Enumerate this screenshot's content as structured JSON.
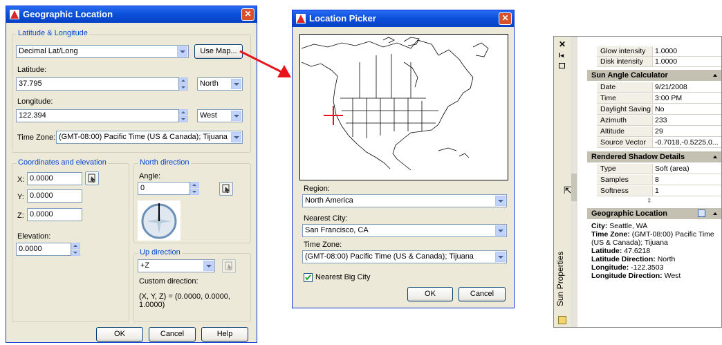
{
  "geo_dialog": {
    "title": "Geographic Location",
    "latlong_group": "Latitude & Longitude",
    "format_value": "Decimal Lat/Long",
    "use_map_label": "Use Map...",
    "latitude_label": "Latitude:",
    "latitude_value": "37.795",
    "latitude_dir": "North",
    "longitude_label": "Longitude:",
    "longitude_value": "122.394",
    "longitude_dir": "West",
    "timezone_label": "Time Zone:",
    "timezone_value": "(GMT-08:00) Pacific Time (US & Canada); Tijuana",
    "coords_group": "Coordinates and elevation",
    "x_label": "X:",
    "x_value": "0.0000",
    "y_label": "Y:",
    "y_value": "0.0000",
    "z_label": "Z:",
    "z_value": "0.0000",
    "elevation_label": "Elevation:",
    "elevation_value": "0.0000",
    "north_group": "North direction",
    "angle_label": "Angle:",
    "angle_value": "0",
    "up_group": "Up direction",
    "up_value": "+Z",
    "custom_dir_label": "Custom direction:",
    "custom_dir_value": "(X, Y, Z) = (0.0000, 0.0000, 1.0000)",
    "ok_label": "OK",
    "cancel_label": "Cancel",
    "help_label": "Help"
  },
  "picker_dialog": {
    "title": "Location Picker",
    "region_label": "Region:",
    "region_value": "North America",
    "city_label": "Nearest City:",
    "city_value": "San Francisco, CA",
    "timezone_label": "Time Zone:",
    "timezone_value": "(GMT-08:00) Pacific Time (US & Canada); Tijuana",
    "nearest_big_city_label": "Nearest Big City",
    "nearest_big_city_checked": true,
    "ok_label": "OK",
    "cancel_label": "Cancel"
  },
  "sun_palette": {
    "side_title": "Sun Properties",
    "top_rows": [
      {
        "name": "Glow intensity",
        "value": "1.0000"
      },
      {
        "name": "Disk intensity",
        "value": "1.0000"
      }
    ],
    "calc_header": "Sun Angle Calculator",
    "calc_rows": [
      {
        "name": "Date",
        "value": "9/21/2008"
      },
      {
        "name": "Time",
        "value": "3:00 PM"
      },
      {
        "name": "Daylight Saving",
        "value": "No"
      },
      {
        "name": "Azimuth",
        "value": "233"
      },
      {
        "name": "Altitude",
        "value": "29"
      },
      {
        "name": "Source Vector",
        "value": "-0.7018,-0.5225,0..."
      }
    ],
    "shadow_header": "Rendered Shadow Details",
    "shadow_rows": [
      {
        "name": "Type",
        "value": "Soft (area)"
      },
      {
        "name": "Samples",
        "value": "8"
      },
      {
        "name": "Softness",
        "value": "1"
      }
    ],
    "geo_header": "Geographic Location",
    "geo_info": {
      "city_label": "City:",
      "city_value": "Seattle, WA",
      "tz_label": "Time Zone:",
      "tz_value": "(GMT-08:00) Pacific Time",
      "tz_value_cont": "(US & Canada); Tijuana",
      "lat_label": "Latitude:",
      "lat_value": "47.6218",
      "latdir_label": "Latitude Direction:",
      "latdir_value": "North",
      "lon_label": "Longitude:",
      "lon_value": "-122.3503",
      "londir_label": "Longitude Direction:",
      "londir_value": "West"
    }
  },
  "colors": {
    "title_blue": "#0a4fd8",
    "group_label_blue": "#0046d5",
    "dialog_face": "#ece9d8",
    "arrow_red": "#e8141b"
  }
}
